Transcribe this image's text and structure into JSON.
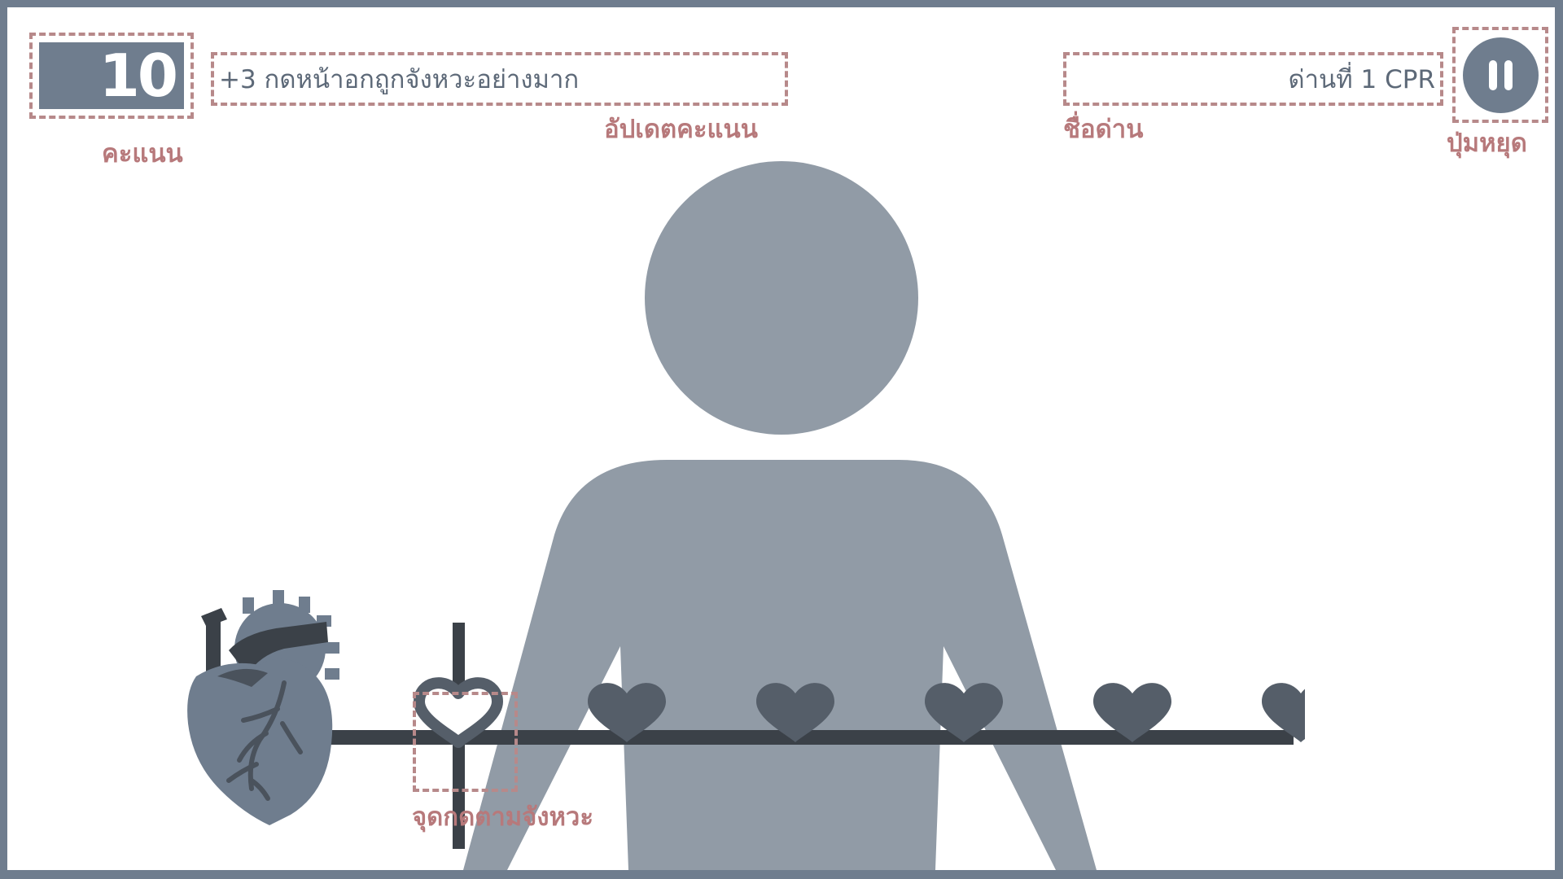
{
  "hud": {
    "score": "10",
    "score_label": "คะแนน",
    "update_text": "+3 กดหน้าอกถูกจังหวะอย่างมาก",
    "update_label": "อัปเดตคะแนน",
    "level_text": "ด่านที่ 1 CPR",
    "level_label": "ชื่อด่าน",
    "pause_label": "ปุ่มหยุด"
  },
  "rhythm": {
    "hit_point_label": "จุดกดตามจังหวะ",
    "beat_count": 6
  },
  "icons": {
    "pause": "pause-icon",
    "heart_organ": "anatomical-heart-icon",
    "beat": "heart-icon",
    "person": "person-silhouette"
  },
  "colors": {
    "frame": "#6f7d8e",
    "annotation": "#b7797b",
    "dash": "#b7898a",
    "heart_dark": "#555e69",
    "person": "#919ba6",
    "track": "#3b4148"
  }
}
